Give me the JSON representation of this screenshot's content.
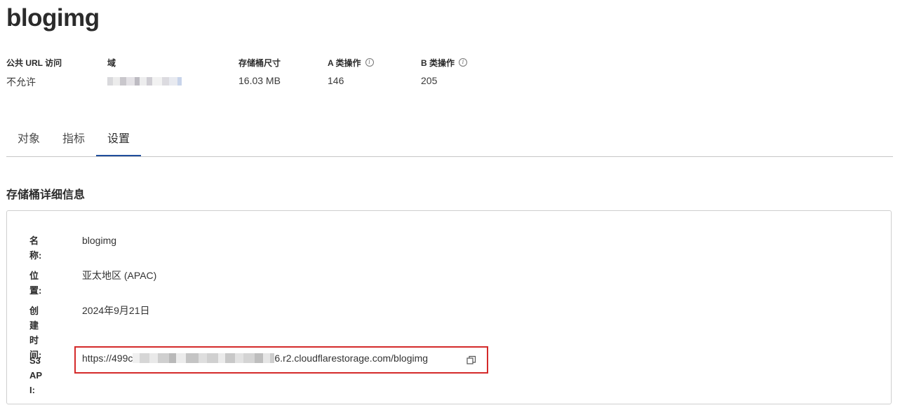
{
  "bucket": {
    "name": "blogimg"
  },
  "stats": [
    {
      "label": "公共 URL 访问",
      "value": "不允许",
      "info": false
    },
    {
      "label": "域",
      "value": "",
      "info": false
    },
    {
      "label": "存储桶尺寸",
      "value": "16.03 MB",
      "info": false
    },
    {
      "label": "A 类操作",
      "value": "146",
      "info": true
    },
    {
      "label": "B 类操作",
      "value": "205",
      "info": true
    }
  ],
  "tabs": [
    {
      "label": "对象",
      "active": false
    },
    {
      "label": "指标",
      "active": false
    },
    {
      "label": "设置",
      "active": true
    }
  ],
  "details": {
    "section_title": "存储桶详细信息",
    "rows": [
      {
        "label": "名称:",
        "value": "blogimg"
      },
      {
        "label": "位置:",
        "value": "亚太地区 (APAC)"
      },
      {
        "label": "创建时间:",
        "value": "2024年9月21日"
      },
      {
        "label": "S3 API:",
        "value_prefix": "https://499c",
        "value_suffix": "6.r2.cloudflarestorage.com/blogimg"
      }
    ]
  },
  "icons": {
    "info": "info-icon",
    "copy": "copy-icon"
  },
  "colors": {
    "tab_active_underline": "#1f4e9c",
    "highlight_box": "#d42a2a"
  }
}
